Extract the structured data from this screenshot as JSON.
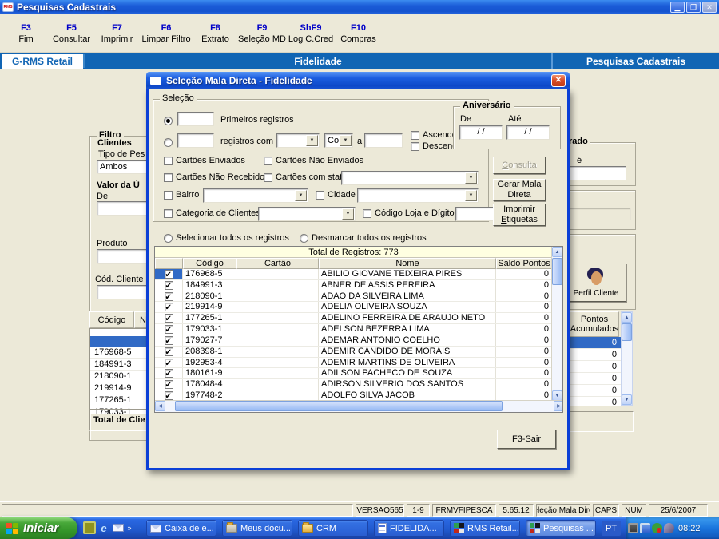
{
  "window": {
    "title": "Pesquisas Cadastrais"
  },
  "toolbar": {
    "items": [
      {
        "key": "F3",
        "label": "Fim"
      },
      {
        "key": "F5",
        "label": "Consultar"
      },
      {
        "key": "F7",
        "label": "Imprimir"
      },
      {
        "key": "F6",
        "label": "Limpar Filtro"
      },
      {
        "key": "F8",
        "label": "Extrato"
      },
      {
        "key": "F9",
        "label": "Seleção MD"
      },
      {
        "key": "ShF9",
        "label": "Log C.Cred"
      },
      {
        "key": "F10",
        "label": "Compras"
      }
    ]
  },
  "tabbar": {
    "left": "G-RMS Retail",
    "center": "Fidelidade",
    "right": "Pesquisas Cadastrais"
  },
  "background": {
    "filtro": {
      "group": "Filtro",
      "clientes": "Clientes",
      "tipo_label": "Tipo de Pes",
      "tipo_value": "Ambos",
      "valor_group": "Valor da Ú",
      "de": "De",
      "produto": "Produto",
      "cod_cliente": "Cód. Cliente"
    },
    "left_table": {
      "col_codigo": "Código",
      "col_n": "N",
      "rows": [
        "176968-5",
        "184991-3",
        "218090-1",
        "219914-9",
        "177265-1",
        "179033-1"
      ],
      "footer": "Total de Clie"
    },
    "right_panel": {
      "group": "rado",
      "ate": "é",
      "perfil": "Perfil Cliente",
      "points_line1": "Pontos",
      "points_line2": "Acumulados",
      "zeros": [
        "0",
        "0",
        "0",
        "0",
        "0",
        "0",
        "0"
      ]
    }
  },
  "dialog": {
    "title": "Seleção Mala Direta - Fidelidade",
    "selecao": {
      "group": "Seleção",
      "primeiros": "Primeiros registros",
      "registros_com": "registros com",
      "co": "Co",
      "a": "a",
      "ascendente": "Ascendente",
      "descendente": "Descendente"
    },
    "aniversario": {
      "group": "Aniversário",
      "de": "De",
      "ate": "Até",
      "de_value": "/ /",
      "ate_value": "/ /"
    },
    "filters": {
      "enviados": "Cartões Enviados",
      "nao_enviados": "Cartões Não Enviados",
      "nao_recebidos": "Cartões Não Recebidos",
      "com_status": "Cartões com status:",
      "bairro": "Bairro",
      "cidade": "Cidade",
      "categoria": "Categoria de Clientes",
      "codigo_loja": "Código Loja e Dígito"
    },
    "buttons": {
      "consulta_u": "C",
      "consulta_rest": "onsulta",
      "gerar_pre": "Gerar ",
      "gerar_u": "M",
      "gerar_post": "ala",
      "gerar_line2": "Direta",
      "imprimir_line1": "Imprimir",
      "imprimir_u": "E",
      "imprimir_post": "tiquetas",
      "sair": "F3-Sair"
    },
    "select_radios": {
      "all": "Selecionar todos os registros",
      "none": "Desmarcar todos os registros"
    },
    "table": {
      "banner": "Total de Registros: 773",
      "columns": [
        "Código",
        "Cartão",
        "Nome",
        "Saldo Pontos"
      ],
      "rows": [
        {
          "codigo": "176968-5",
          "cartao": "",
          "nome": "ABILIO GIOVANE TEIXEIRA PIRES",
          "saldo": "0"
        },
        {
          "codigo": "184991-3",
          "cartao": "",
          "nome": "ABNER DE ASSIS PEREIRA",
          "saldo": "0"
        },
        {
          "codigo": "218090-1",
          "cartao": "",
          "nome": "ADAO DA SILVEIRA LIMA",
          "saldo": "0"
        },
        {
          "codigo": "219914-9",
          "cartao": "",
          "nome": "ADELIA OLIVEIRA SOUZA",
          "saldo": "0"
        },
        {
          "codigo": "177265-1",
          "cartao": "",
          "nome": "ADELINO FERREIRA DE ARAUJO NETO",
          "saldo": "0"
        },
        {
          "codigo": "179033-1",
          "cartao": "",
          "nome": "ADELSON BEZERRA LIMA",
          "saldo": "0"
        },
        {
          "codigo": "179027-7",
          "cartao": "",
          "nome": "ADEMAR ANTONIO COELHO",
          "saldo": "0"
        },
        {
          "codigo": "208398-1",
          "cartao": "",
          "nome": "ADEMIR CANDIDO DE MORAIS",
          "saldo": "0"
        },
        {
          "codigo": "192953-4",
          "cartao": "",
          "nome": "ADEMIR MARTINS DE OLIVEIRA",
          "saldo": "0"
        },
        {
          "codigo": "180161-9",
          "cartao": "",
          "nome": "ADILSON PACHECO DE SOUZA",
          "saldo": "0"
        },
        {
          "codigo": "178048-4",
          "cartao": "",
          "nome": "ADIRSON SILVERIO DOS SANTOS",
          "saldo": "0"
        },
        {
          "codigo": "197748-2",
          "cartao": "",
          "nome": "ADOLFO SILVA JACOB",
          "saldo": "0"
        }
      ]
    }
  },
  "statusbar": {
    "cells": [
      "VERSAO565",
      "1-9",
      "FRMVFIPESCA",
      "5.65.12",
      "eleção Mala Dire",
      "CAPS",
      "NUM",
      "25/6/2007"
    ]
  },
  "taskbar": {
    "start": "Iniciar",
    "tasks": [
      {
        "label": "Caixa de e..."
      },
      {
        "label": "Meus docu..."
      },
      {
        "label": "CRM"
      },
      {
        "label": "FIDELIDA..."
      },
      {
        "label": "RMS Retail..."
      },
      {
        "label": "Pesquisas ..."
      }
    ],
    "lang": "PT",
    "clock": "08:22"
  }
}
